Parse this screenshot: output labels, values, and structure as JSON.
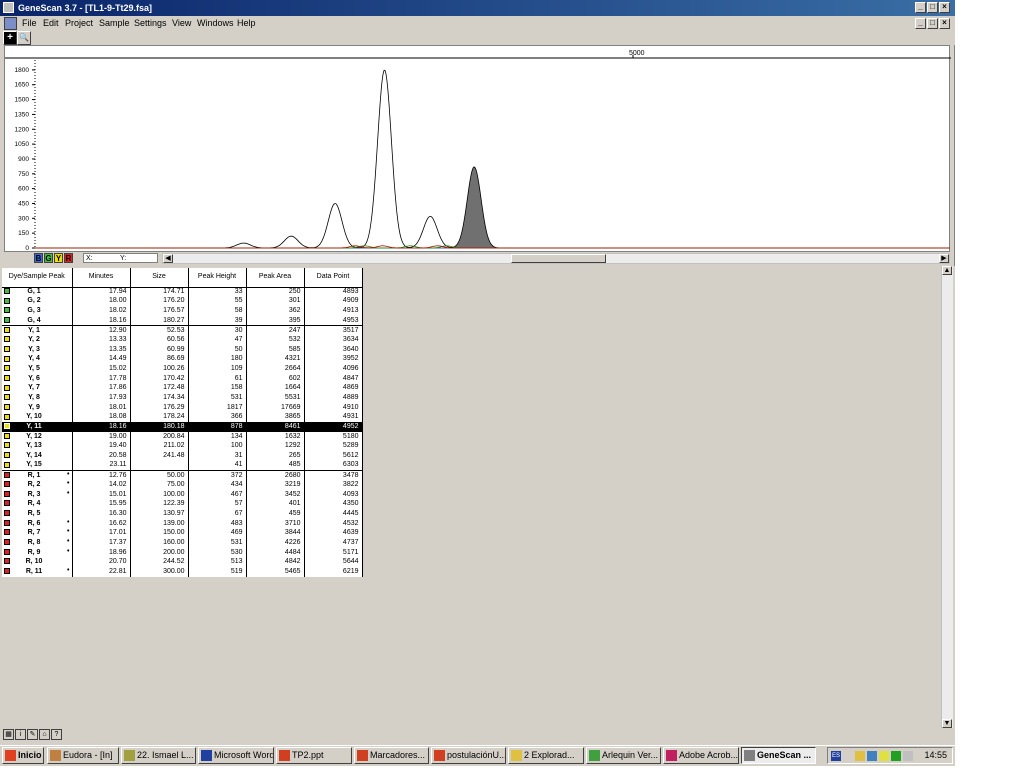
{
  "window": {
    "title": "GeneScan 3.7 - [TL1-9-Tt29.fsa]",
    "controls": [
      "_",
      "□",
      "×"
    ],
    "doc_controls": [
      "_",
      "□",
      "×"
    ]
  },
  "menu": [
    "File",
    "Edit",
    "Project",
    "Sample",
    "Settings",
    "View",
    "Windows",
    "Help"
  ],
  "toolbar": {
    "zoom_label": "+",
    "search_label": "🔍"
  },
  "chart_data": {
    "type": "line",
    "ruler_label": "5000",
    "y_ticks": [
      0,
      150,
      300,
      450,
      600,
      750,
      900,
      1050,
      1200,
      1350,
      1500,
      1650,
      1800
    ],
    "ylim": [
      0,
      1900
    ],
    "series": [
      {
        "dye": "Y",
        "color": "#000000",
        "peaks": [
          {
            "x": 0.228,
            "h": 50
          },
          {
            "x": 0.28,
            "h": 120
          },
          {
            "x": 0.328,
            "h": 450
          },
          {
            "x": 0.382,
            "h": 1800
          },
          {
            "x": 0.432,
            "h": 320
          },
          {
            "x": 0.48,
            "h": 820,
            "filled": true
          }
        ]
      },
      {
        "dye": "G",
        "color": "#00a000"
      },
      {
        "dye": "R",
        "color": "#d00000"
      }
    ]
  },
  "dye_buttons": [
    {
      "label": "B",
      "color": "#3a6ad8"
    },
    {
      "label": "G",
      "color": "#40c040"
    },
    {
      "label": "Y",
      "color": "#f0e000"
    },
    {
      "label": "R",
      "color": "#e02020"
    }
  ],
  "coords": {
    "x_label": "X:",
    "y_label": "Y:"
  },
  "table": {
    "headers": [
      "Dye/Sample Peak",
      "Minutes",
      "Size",
      "Peak Height",
      "Peak Area",
      "Data Point"
    ],
    "rows": [
      {
        "color": "#40c040",
        "peak": "G, 1",
        "minutes": "17.94",
        "size": "174.71",
        "height": "33",
        "area": "250",
        "point": "4893",
        "group_start": false
      },
      {
        "color": "#40c040",
        "peak": "G, 2",
        "minutes": "18.00",
        "size": "176.20",
        "height": "55",
        "area": "301",
        "point": "4909"
      },
      {
        "color": "#40c040",
        "peak": "G, 3",
        "minutes": "18.02",
        "size": "176.57",
        "height": "58",
        "area": "362",
        "point": "4913"
      },
      {
        "color": "#40c040",
        "peak": "G, 4",
        "minutes": "18.16",
        "size": "180.27",
        "height": "39",
        "area": "395",
        "point": "4953"
      },
      {
        "color": "#f0e000",
        "peak": "Y, 1",
        "minutes": "12.90",
        "size": "52.53",
        "height": "30",
        "area": "247",
        "point": "3517",
        "group_start": true
      },
      {
        "color": "#f0e000",
        "peak": "Y, 2",
        "minutes": "13.33",
        "size": "60.56",
        "height": "47",
        "area": "532",
        "point": "3634"
      },
      {
        "color": "#f0e000",
        "peak": "Y, 3",
        "minutes": "13.35",
        "size": "60.99",
        "height": "50",
        "area": "585",
        "point": "3640"
      },
      {
        "color": "#f0e000",
        "peak": "Y, 4",
        "minutes": "14.49",
        "size": "86.69",
        "height": "180",
        "area": "4321",
        "point": "3952"
      },
      {
        "color": "#f0e000",
        "peak": "Y, 5",
        "minutes": "15.02",
        "size": "100.26",
        "height": "109",
        "area": "2664",
        "point": "4096"
      },
      {
        "color": "#f0e000",
        "peak": "Y, 6",
        "minutes": "17.78",
        "size": "170.42",
        "height": "61",
        "area": "602",
        "point": "4847"
      },
      {
        "color": "#f0e000",
        "peak": "Y, 7",
        "minutes": "17.86",
        "size": "172.48",
        "height": "158",
        "area": "1664",
        "point": "4869"
      },
      {
        "color": "#f0e000",
        "peak": "Y, 8",
        "minutes": "17.93",
        "size": "174.34",
        "height": "531",
        "area": "5531",
        "point": "4889"
      },
      {
        "color": "#f0e000",
        "peak": "Y, 9",
        "minutes": "18.01",
        "size": "176.29",
        "height": "1817",
        "area": "17669",
        "point": "4910"
      },
      {
        "color": "#f0e000",
        "peak": "Y, 10",
        "minutes": "18.08",
        "size": "178.24",
        "height": "366",
        "area": "3865",
        "point": "4931"
      },
      {
        "color": "#f0e000",
        "peak": "Y, 11",
        "minutes": "18.16",
        "size": "180.18",
        "height": "878",
        "area": "8461",
        "point": "4952",
        "selected": true
      },
      {
        "color": "#f0e000",
        "peak": "Y, 12",
        "minutes": "19.00",
        "size": "200.84",
        "height": "134",
        "area": "1632",
        "point": "5180"
      },
      {
        "color": "#f0e000",
        "peak": "Y, 13",
        "minutes": "19.40",
        "size": "211.02",
        "height": "100",
        "area": "1292",
        "point": "5289"
      },
      {
        "color": "#f0e000",
        "peak": "Y, 14",
        "minutes": "20.58",
        "size": "241.48",
        "height": "31",
        "area": "265",
        "point": "5612"
      },
      {
        "color": "#f0e000",
        "peak": "Y, 15",
        "minutes": "23.11",
        "size": "",
        "height": "41",
        "area": "485",
        "point": "6303"
      },
      {
        "color": "#e02020",
        "peak": "R, 1",
        "dot": "•",
        "minutes": "12.76",
        "size": "50.00",
        "height": "372",
        "area": "2680",
        "point": "3478",
        "group_start": true
      },
      {
        "color": "#e02020",
        "peak": "R, 2",
        "dot": "•",
        "minutes": "14.02",
        "size": "75.00",
        "height": "434",
        "area": "3219",
        "point": "3822"
      },
      {
        "color": "#e02020",
        "peak": "R, 3",
        "dot": "•",
        "minutes": "15.01",
        "size": "100.00",
        "height": "467",
        "area": "3452",
        "point": "4093"
      },
      {
        "color": "#e02020",
        "peak": "R, 4",
        "minutes": "15.95",
        "size": "122.39",
        "height": "57",
        "area": "401",
        "point": "4350"
      },
      {
        "color": "#e02020",
        "peak": "R, 5",
        "minutes": "16.30",
        "size": "130.97",
        "height": "67",
        "area": "459",
        "point": "4445"
      },
      {
        "color": "#e02020",
        "peak": "R, 6",
        "dot": "•",
        "minutes": "16.62",
        "size": "139.00",
        "height": "483",
        "area": "3710",
        "point": "4532"
      },
      {
        "color": "#e02020",
        "peak": "R, 7",
        "dot": "•",
        "minutes": "17.01",
        "size": "150.00",
        "height": "469",
        "area": "3844",
        "point": "4639"
      },
      {
        "color": "#e02020",
        "peak": "R, 8",
        "dot": "•",
        "minutes": "17.37",
        "size": "160.00",
        "height": "531",
        "area": "4226",
        "point": "4737"
      },
      {
        "color": "#e02020",
        "peak": "R, 9",
        "dot": "•",
        "minutes": "18.96",
        "size": "200.00",
        "height": "530",
        "area": "4484",
        "point": "5171"
      },
      {
        "color": "#e02020",
        "peak": "R, 10",
        "minutes": "20.70",
        "size": "244.52",
        "height": "513",
        "area": "4842",
        "point": "5644"
      },
      {
        "color": "#e02020",
        "peak": "R, 11",
        "dot": "•",
        "minutes": "22.81",
        "size": "300.00",
        "height": "519",
        "area": "5465",
        "point": "6219"
      }
    ]
  },
  "taskbar": {
    "start": "Inicio",
    "tasks": [
      {
        "label": "Eudora - [In]",
        "icon": "#c08040"
      },
      {
        "label": "22. Ismael L...",
        "icon": "#a0a040"
      },
      {
        "label": "Microsoft Word",
        "icon": "#2040a0"
      },
      {
        "label": "TP2.ppt",
        "icon": "#d04020"
      },
      {
        "label": "Marcadores...",
        "icon": "#d04020"
      },
      {
        "label": "postulaciónU...",
        "icon": "#d04020"
      },
      {
        "label": "2 Explorad...",
        "icon": "#e0c040"
      },
      {
        "label": "Arlequin Ver...",
        "icon": "#40a040"
      },
      {
        "label": "Adobe Acrob...",
        "icon": "#c02060"
      },
      {
        "label": "GeneScan ...",
        "icon": "#808080",
        "active": true
      }
    ],
    "clock": "14:55",
    "lang": "ES"
  }
}
